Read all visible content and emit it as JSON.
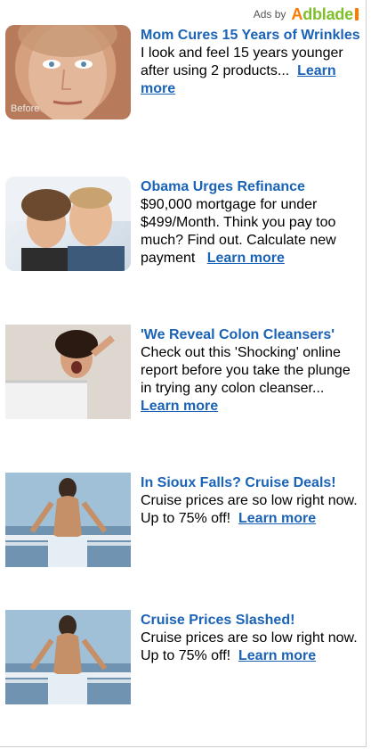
{
  "attribution": {
    "ads_by_label": "Ads by",
    "brand_a": "A",
    "brand_rest": "dblade"
  },
  "ads": [
    {
      "title": "Mom Cures 15 Years of Wrinkles",
      "description": "I look and feel 15 years younger after using 2 products...",
      "cta": "Learn more",
      "image_caption": "Before",
      "image_icon": "face-photo"
    },
    {
      "title": "Obama Urges Refinance",
      "description": "$90,000 mortgage for under $499/Month. Think you pay too much? Find out. Calculate new payment",
      "cta": "Learn more",
      "image_icon": "couple-photo"
    },
    {
      "title": "'We Reveal Colon Cleansers'",
      "description": "Check out this 'Shocking' online report before you take the plunge in trying any colon cleanser...",
      "cta": "Learn more",
      "image_icon": "screaming-woman-photo"
    },
    {
      "title": "In Sioux Falls? Cruise Deals!",
      "description": "Cruise prices are so low right now. Up to 75% off!",
      "cta": "Learn more",
      "image_icon": "cruise-woman-photo"
    },
    {
      "title": "Cruise Prices Slashed!",
      "description": "Cruise prices are so low right now. Up to 75% off!",
      "cta": "Learn more",
      "image_icon": "cruise-woman-photo"
    }
  ],
  "colors": {
    "link_blue": "#1a63b6",
    "brand_orange": "#ff7a00",
    "brand_green": "#7fbf2a"
  }
}
